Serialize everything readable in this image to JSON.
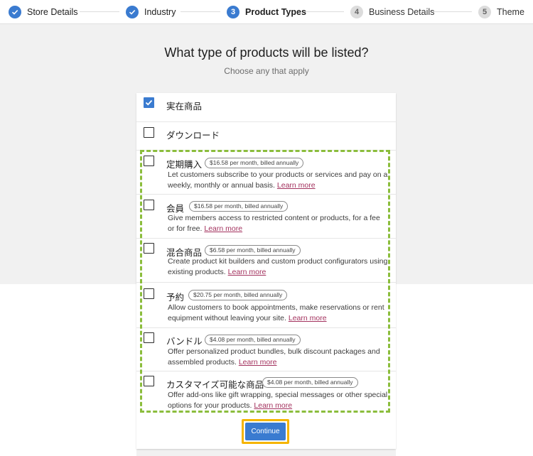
{
  "stepper": {
    "steps": [
      {
        "label": "Store Details",
        "status": "done",
        "number": ""
      },
      {
        "label": "Industry",
        "status": "done",
        "number": ""
      },
      {
        "label": "Product Types",
        "status": "active",
        "number": "3"
      },
      {
        "label": "Business Details",
        "status": "todo",
        "number": "4"
      },
      {
        "label": "Theme",
        "status": "todo",
        "number": "5"
      }
    ]
  },
  "header": {
    "title": "What type of products will be listed?",
    "subtitle": "Choose any that apply"
  },
  "options": [
    {
      "title": "実在商品",
      "checked": true
    },
    {
      "title": "ダウンロード",
      "checked": false
    },
    {
      "title": "定期購入",
      "checked": false,
      "price": "$16.58 per month, billed annually",
      "description": "Let customers subscribe to your products or services and pay on a weekly, monthly or annual basis.",
      "learn_more": "Learn more"
    },
    {
      "title": "会員",
      "checked": false,
      "price": "$16.58 per month, billed annually",
      "description": "Give members access to restricted content or products, for a fee or for free.",
      "learn_more": "Learn more"
    },
    {
      "title": "混合商品",
      "checked": false,
      "price": "$6.58 per month, billed annually",
      "description": "Create product kit builders and custom product configurators using existing products.",
      "learn_more": "Learn more"
    },
    {
      "title": "予約",
      "checked": false,
      "price": "$20.75 per month, billed annually",
      "description": "Allow customers to book appointments, make reservations or rent equipment without leaving your site.",
      "learn_more": "Learn more"
    },
    {
      "title": "バンドル",
      "checked": false,
      "price": "$4.08 per month, billed annually",
      "description": "Offer personalized product bundles, bulk discount packages and assembled products.",
      "learn_more": "Learn more"
    },
    {
      "title": "カスタマイズ可能な商品",
      "checked": false,
      "price": "$4.08 per month, billed annually",
      "description": "Offer add-ons like gift wrapping, special messages or other special options for your products.",
      "learn_more": "Learn more"
    }
  ],
  "footer": {
    "continue_label": "Continue"
  },
  "colors": {
    "accent": "#3a7bd0",
    "highlight_dashed": "#8bbd3c",
    "highlight_button": "#f5b400",
    "link": "#a3325e"
  }
}
